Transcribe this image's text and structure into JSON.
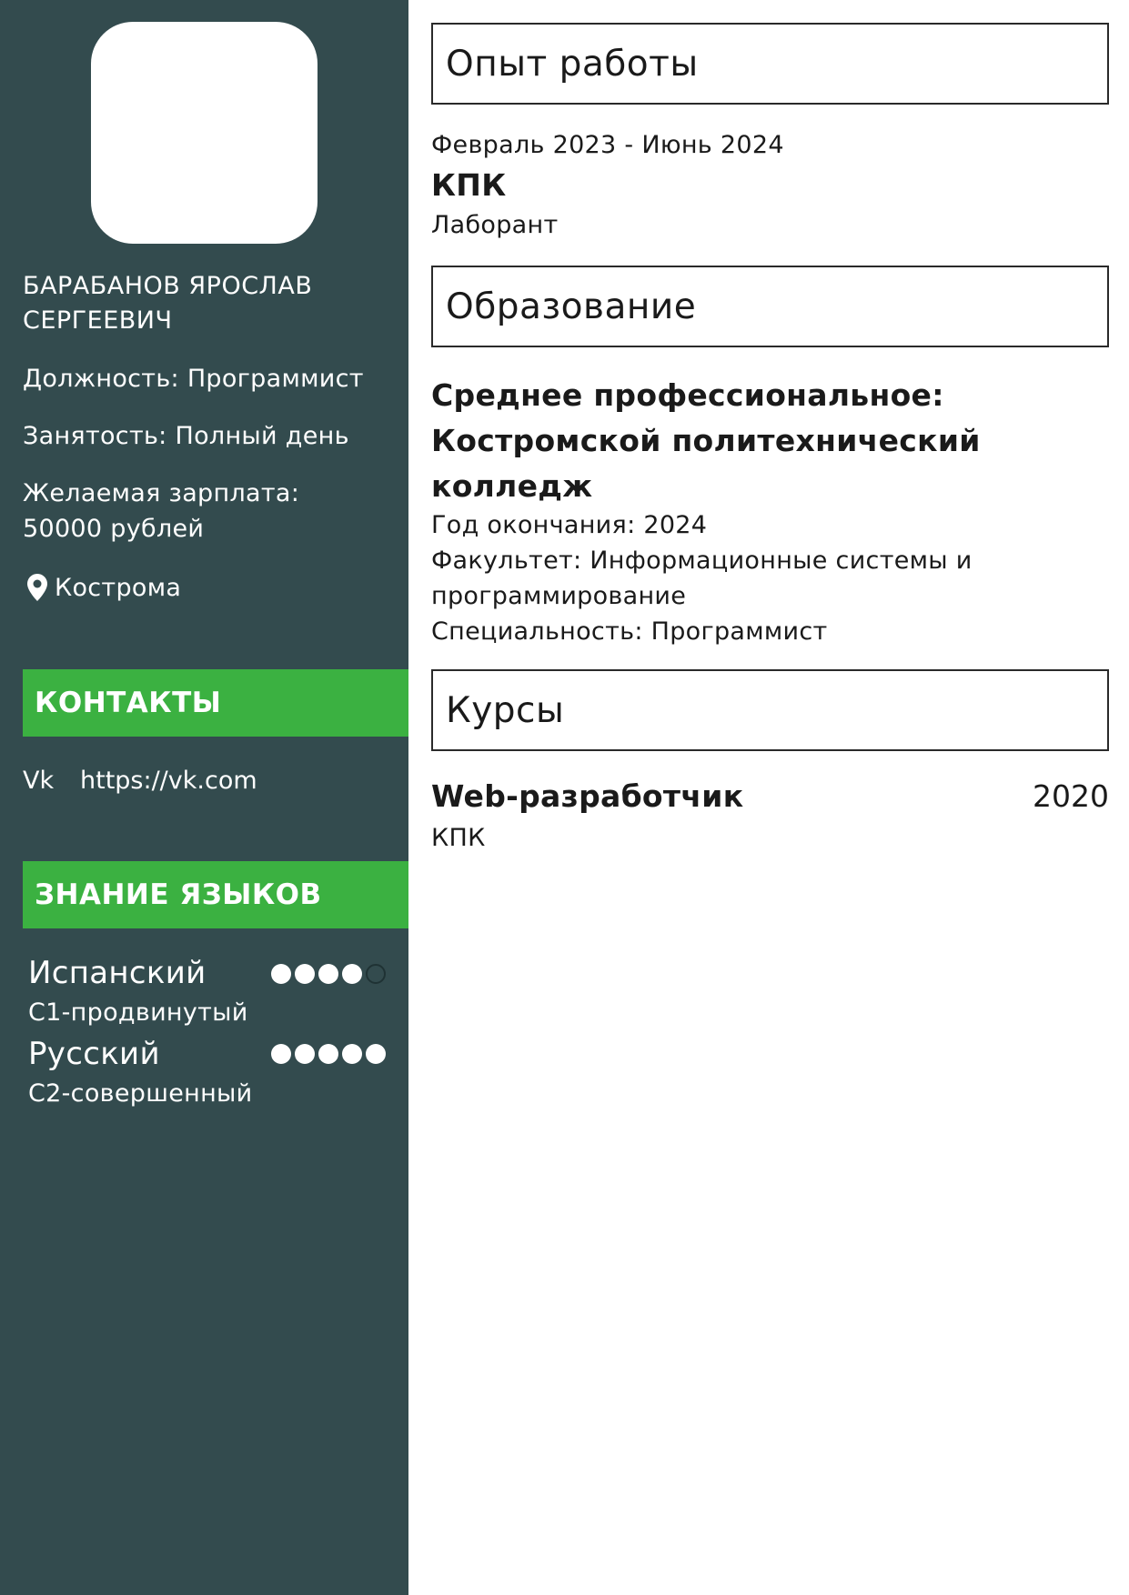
{
  "profile": {
    "name": "БАРАБАНОВ ЯРОСЛАВ СЕРГЕЕВИЧ",
    "position": "Должность: Программист",
    "employment": "Занятость: Полный день",
    "salary_label": "Желаемая зарплата:",
    "salary_value": "50000 рублей",
    "location": "Кострома",
    "location_icon": "map-pin-icon"
  },
  "contacts": {
    "title": "КОНТАКТЫ",
    "items": [
      {
        "label": "Vk",
        "value": "https://vk.com"
      }
    ]
  },
  "languages": {
    "title": "ЗНАНИЕ ЯЗЫКОВ",
    "items": [
      {
        "name": "Испанский",
        "level": "C1-продвинутый",
        "rating": 4,
        "max": 5
      },
      {
        "name": "Русский",
        "level": "C2-совершенный",
        "rating": 5,
        "max": 5
      }
    ]
  },
  "experience": {
    "title": "Опыт работы",
    "items": [
      {
        "period": "Февраль 2023 - Июнь 2024",
        "company": "КПК",
        "role": "Лаборант"
      }
    ]
  },
  "education": {
    "title": "Образование",
    "items": [
      {
        "title": "Среднее профессиональное: Костромской политехнический колледж",
        "year": "Год окончания: 2024",
        "faculty": "Факультет: Информационные системы и программирование",
        "specialty": "Специальность: Программист"
      }
    ]
  },
  "courses": {
    "title": "Курсы",
    "items": [
      {
        "name": "Web-разработчик",
        "org": "КПК",
        "year": "2020"
      }
    ]
  },
  "colors": {
    "sidebar": "#334b4e",
    "accent": "#3bb141",
    "text": "#1a1a1a"
  }
}
